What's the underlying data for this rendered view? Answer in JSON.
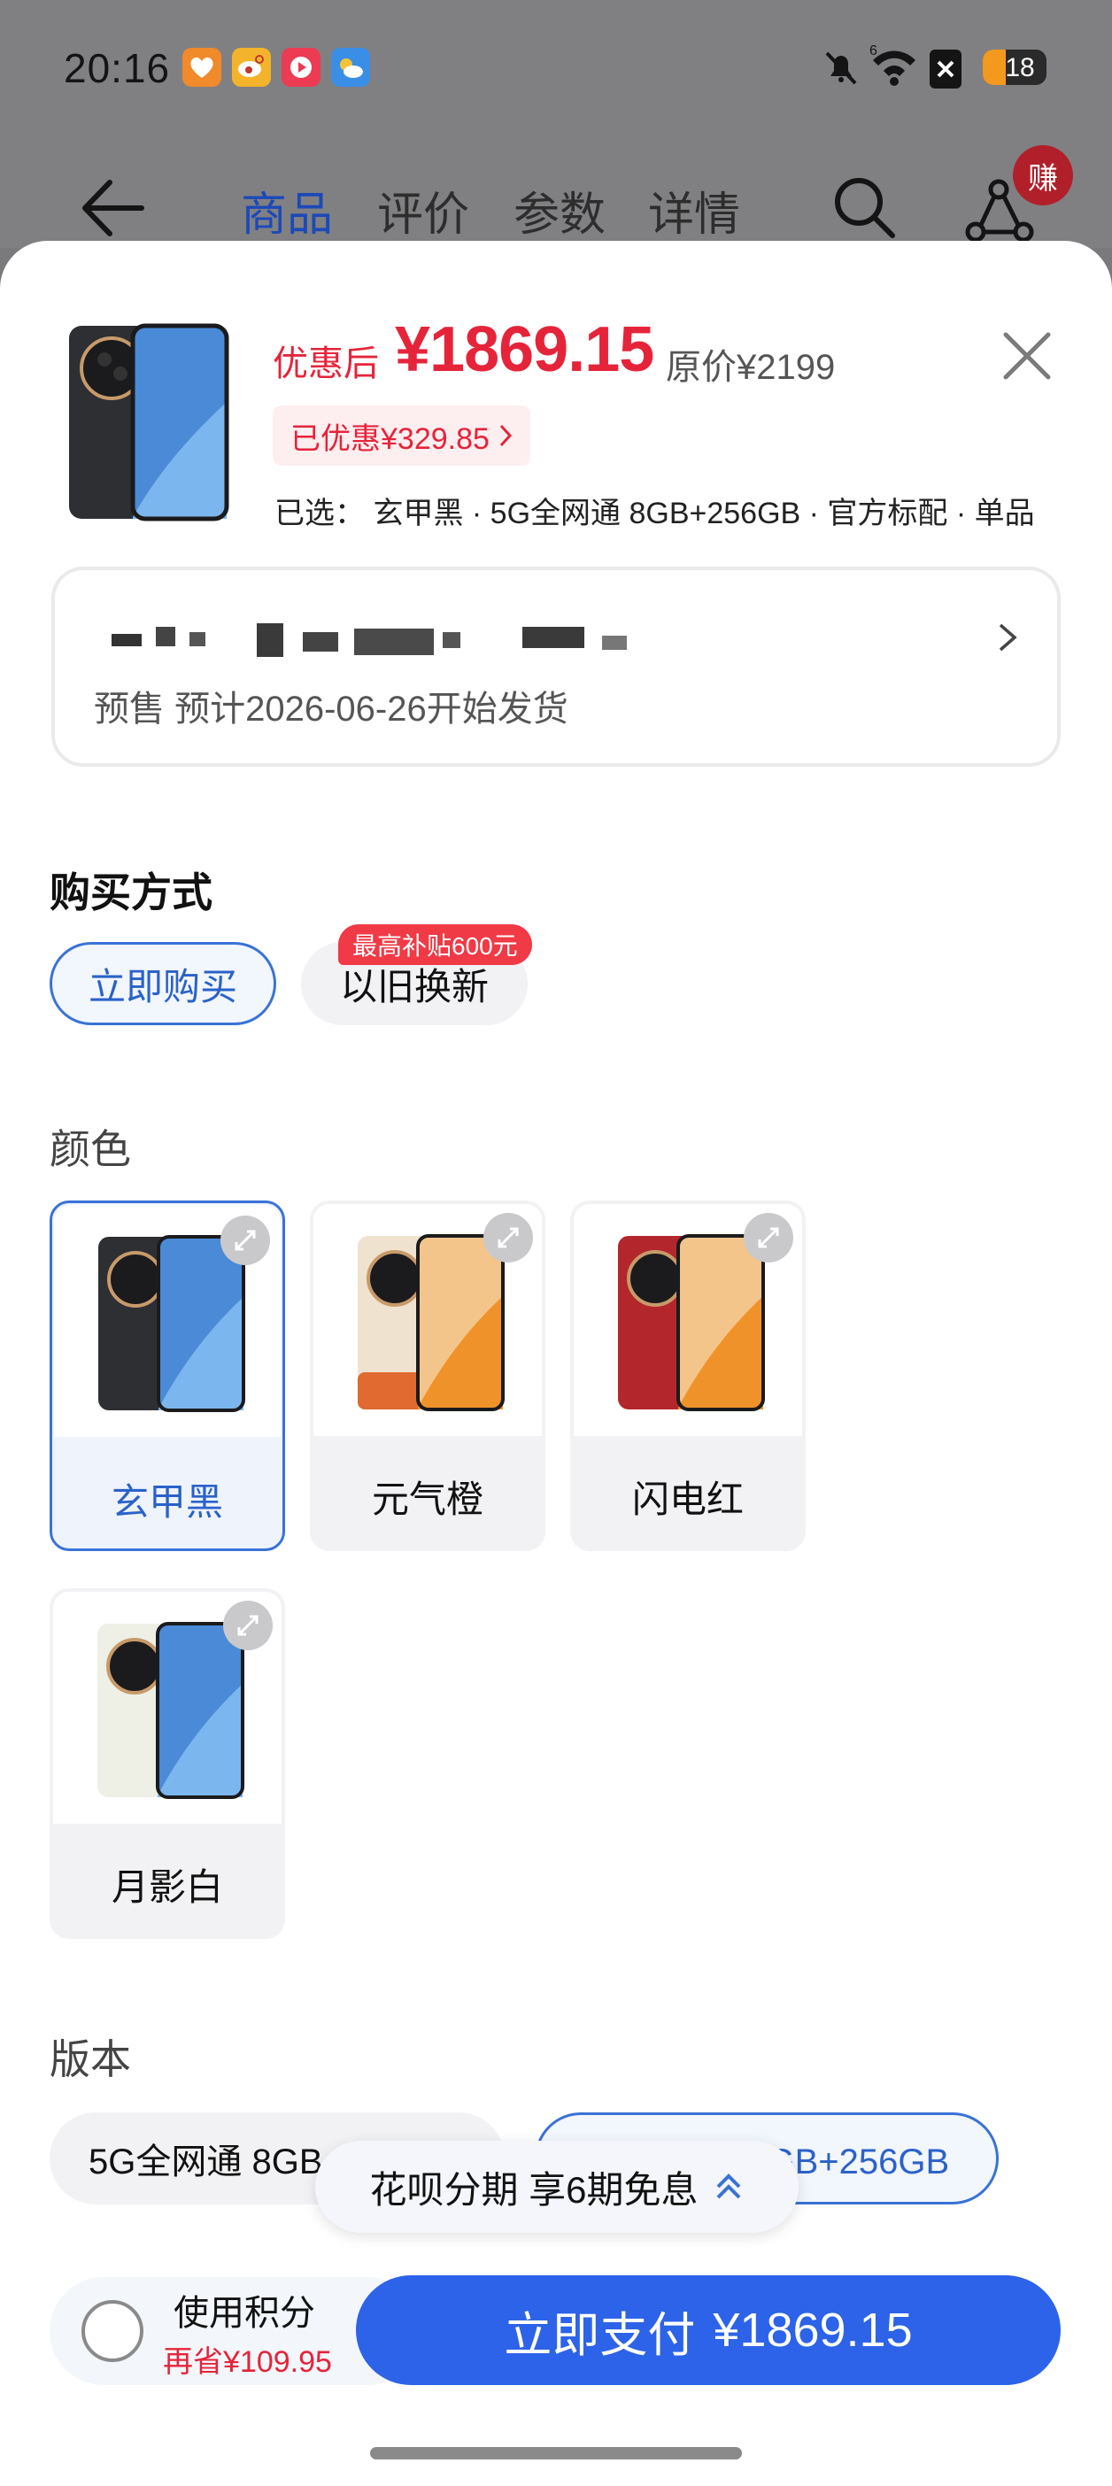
{
  "status_bar": {
    "time": "20:16",
    "battery": "18",
    "signal_label": "6"
  },
  "nav": {
    "tabs": [
      {
        "label": "商品",
        "active": true
      },
      {
        "label": "评价"
      },
      {
        "label": "参数"
      },
      {
        "label": "详情"
      }
    ],
    "earn_badge": "赚"
  },
  "product": {
    "price_label": "优惠后",
    "price": "¥1869.15",
    "original_price": "原价¥2199",
    "discount": "已优惠¥329.85",
    "selected": "已选：  玄甲黑 · 5G全网通 8GB+256GB · 官方标配 · 单品"
  },
  "address": {
    "status": "预售 预计2026-06-26开始发货"
  },
  "purchase": {
    "title": "购买方式",
    "options": [
      "立即购买",
      "以旧换新"
    ],
    "trade_in_badge": "最高补贴600元"
  },
  "color": {
    "title": "颜色",
    "options": [
      {
        "label": "玄甲黑",
        "body": "#2d2f33",
        "screen": "#4a8ad6"
      },
      {
        "label": "元气橙",
        "body": "#efe3cf",
        "screen": "#f2a23a"
      },
      {
        "label": "闪电红",
        "body": "#b3262c",
        "screen": "#f2a23a"
      },
      {
        "label": "月影白",
        "body": "#eef0e6",
        "screen": "#4a8ad6"
      }
    ]
  },
  "version": {
    "title": "版本",
    "options": [
      "5G全网通 8GB+128GB",
      "5G全网通 8GB+256GB"
    ]
  },
  "installment": {
    "label": "花呗分期  享6期免息"
  },
  "bottom": {
    "points_label": "使用积分",
    "points_save": "再省¥109.95",
    "pay_label": "立即支付",
    "pay_amount": "¥1869.15"
  },
  "colors": {
    "accent": "#2d63e8",
    "price_red": "#e5243a"
  }
}
